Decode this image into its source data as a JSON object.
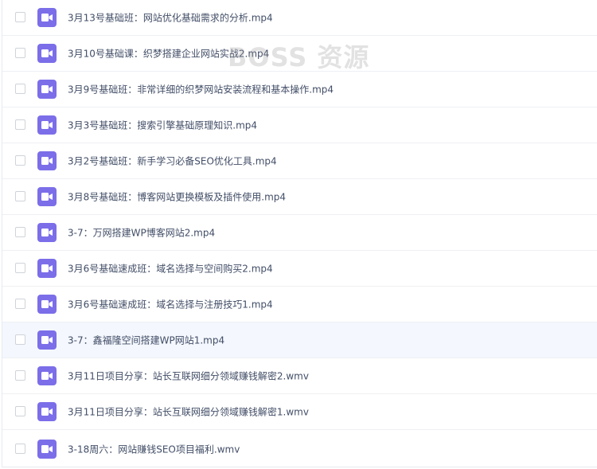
{
  "watermark": "BOSS 资源",
  "files": [
    {
      "name": "3月13号基础班：网站优化基础需求的分析.mp4",
      "icon": "video-file-icon"
    },
    {
      "name": "3月10号基础课：织梦搭建企业网站实战2.mp4",
      "icon": "video-file-icon"
    },
    {
      "name": "3月9号基础班：非常详细的织梦网站安装流程和基本操作.mp4",
      "icon": "video-file-icon"
    },
    {
      "name": "3月3号基础班：搜索引擎基础原理知识.mp4",
      "icon": "video-file-icon"
    },
    {
      "name": "3月2号基础班：新手学习必备SEO优化工具.mp4",
      "icon": "video-file-icon"
    },
    {
      "name": "3月8号基础班：博客网站更换模板及插件使用.mp4",
      "icon": "video-file-icon"
    },
    {
      "name": "3-7：万网搭建WP博客网站2.mp4",
      "icon": "video-file-icon"
    },
    {
      "name": "3月6号基础速成班：域名选择与空间购买2.mp4",
      "icon": "video-file-icon"
    },
    {
      "name": "3月6号基础速成班：域名选择与注册技巧1.mp4",
      "icon": "video-file-icon"
    },
    {
      "name": "3-7：鑫福隆空间搭建WP网站1.mp4",
      "icon": "video-file-icon"
    },
    {
      "name": "3月11日项目分享：站长互联网细分领域赚钱解密2.wmv",
      "icon": "video-file-icon"
    },
    {
      "name": "3月11日项目分享：站长互联网细分领域赚钱解密1.wmv",
      "icon": "video-file-icon"
    },
    {
      "name": "3-18周六：网站赚钱SEO项目福利.wmv",
      "icon": "video-file-icon"
    }
  ],
  "colors": {
    "icon": "#7b6ee8",
    "hover_row": "#f4f7fd",
    "text": "#424e67"
  }
}
